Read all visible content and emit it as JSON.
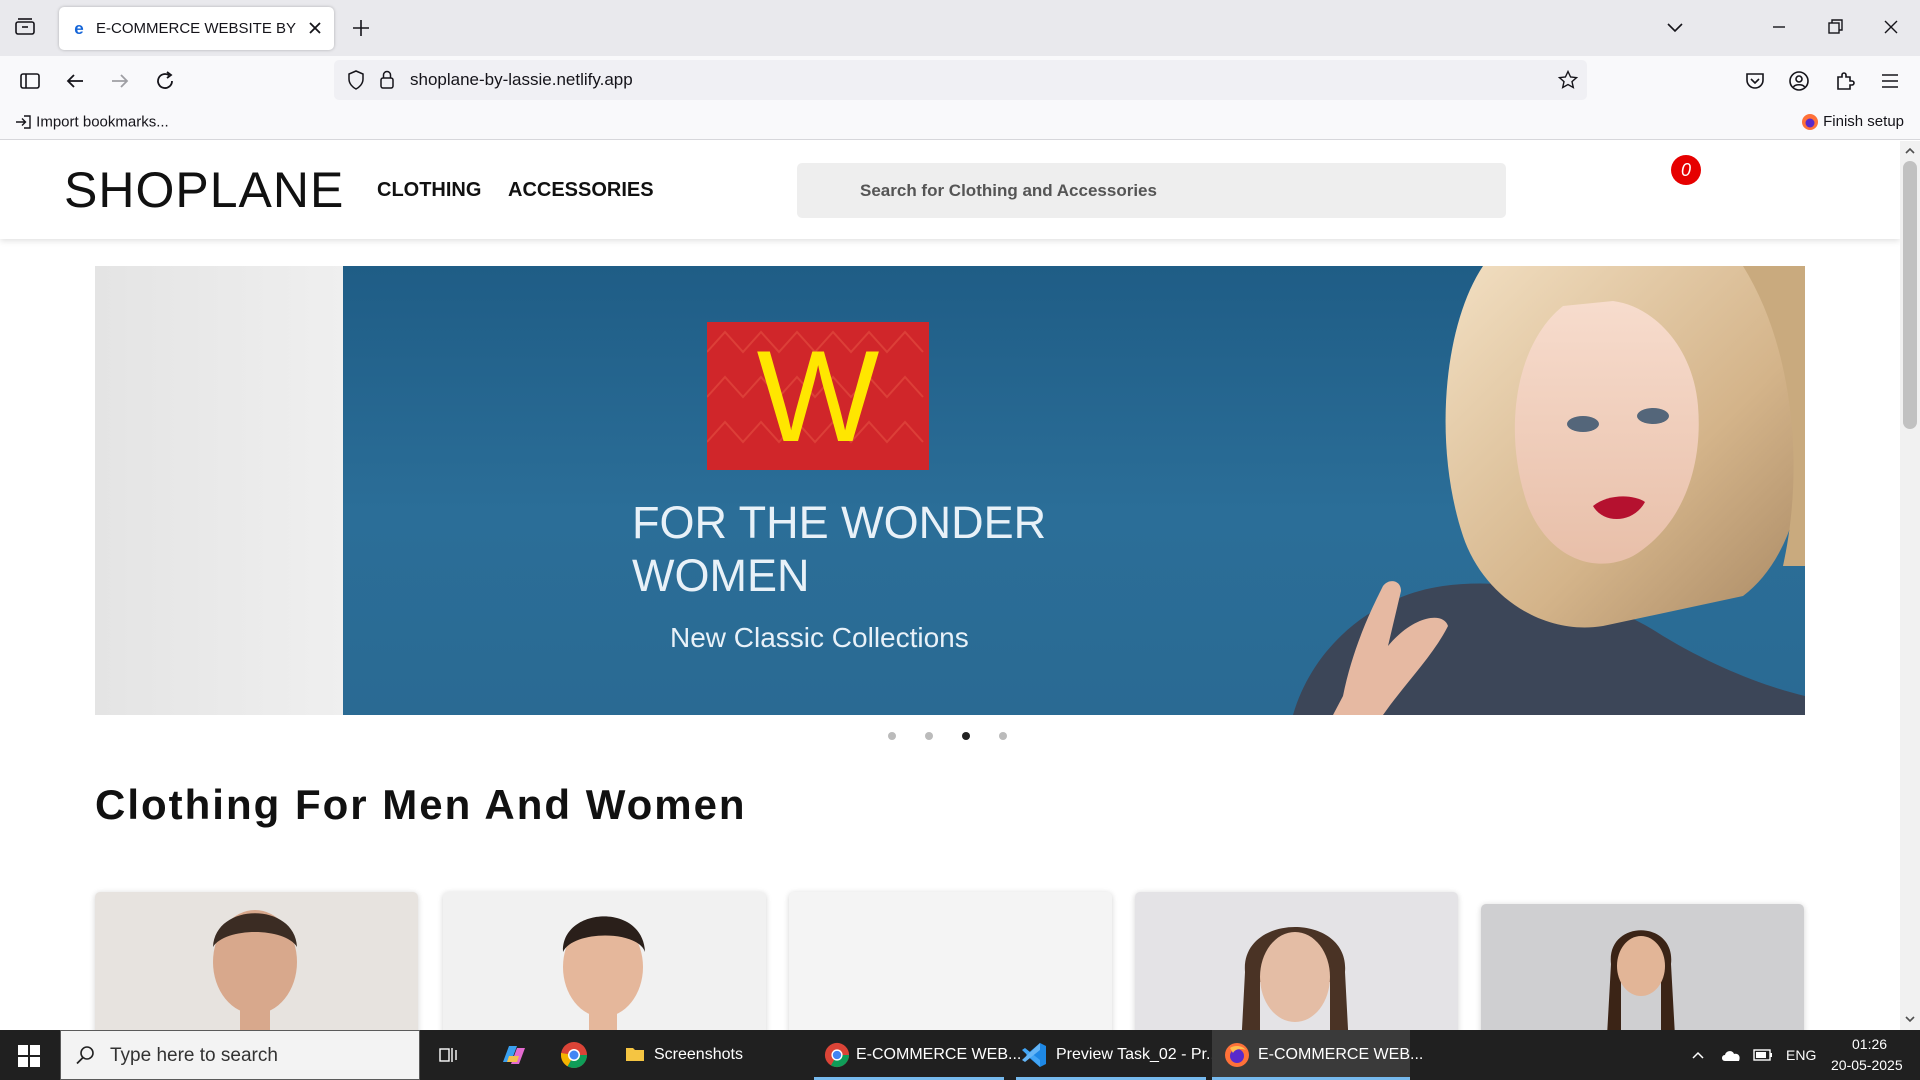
{
  "browser": {
    "tab_title": "E-COMMERCE WEBSITE BY EDYODA",
    "tab_favicon": "e",
    "url": "shoplane-by-lassie.netlify.app",
    "bookmarks": {
      "import_label": "Import bookmarks...",
      "finish_label": "Finish setup"
    }
  },
  "site": {
    "logo": "SHOPLANE",
    "menu": [
      "CLOTHING",
      "ACCESSORIES"
    ],
    "search_placeholder": "Search for Clothing and Accessories",
    "cart_count": "0",
    "banner": {
      "brand_letter": "W",
      "title": "FOR THE WONDER WOMEN",
      "subtitle": "New Classic Collections",
      "slide_count": 4,
      "active_slide": 3
    },
    "section_title": "Clothing For Men And Women"
  },
  "taskbar": {
    "search_placeholder": "Type here to search",
    "items": [
      "Screenshots",
      "E-COMMERCE WEB...",
      "Preview Task_02 - Pr...",
      "E-COMMERCE WEB..."
    ],
    "language": "ENG",
    "time": "01:26",
    "date": "20-05-2025"
  },
  "colors": {
    "accent_red": "#e60000",
    "banner_blue": "#2b6e98",
    "brand_red": "#d0262a",
    "brand_yellow": "#ffe600"
  }
}
